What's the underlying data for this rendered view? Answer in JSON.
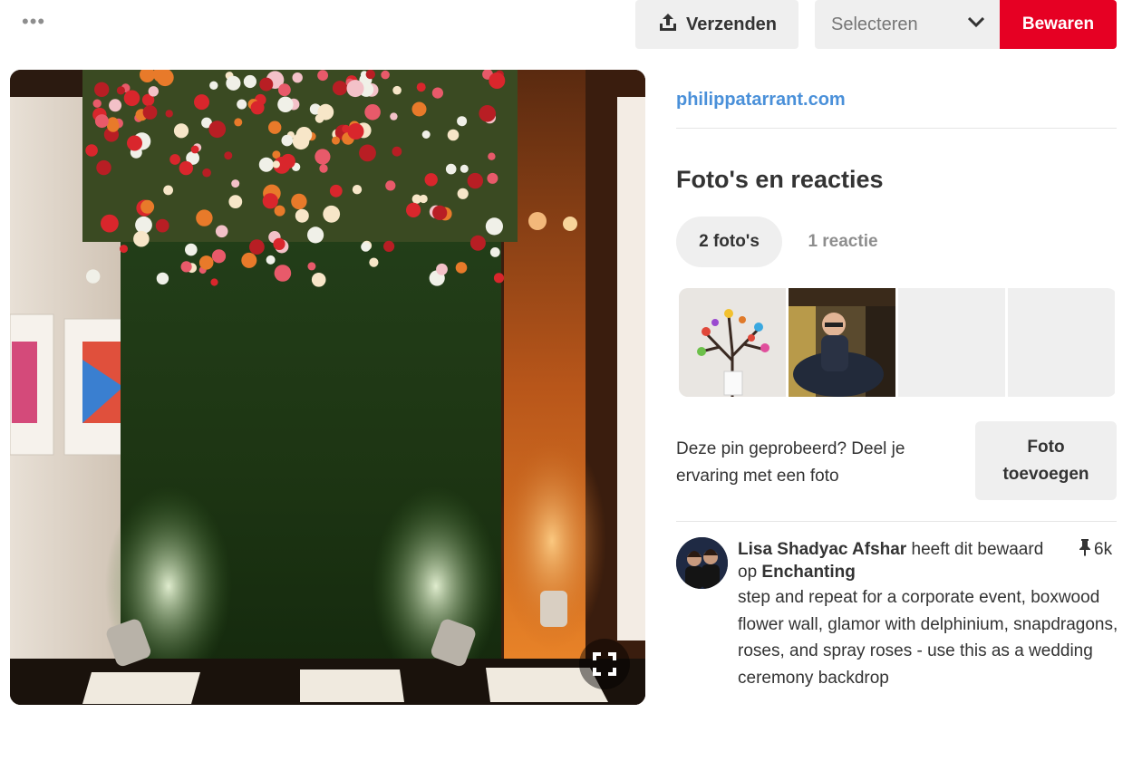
{
  "toolbar": {
    "more_icon": "more-horizontal-icon",
    "send_label": "Verzenden",
    "send_icon": "share-upload-icon",
    "select_label": "Selecteren",
    "select_icon": "chevron-down-icon",
    "save_label": "Bewaren",
    "accent_color": "#e60023"
  },
  "hero": {
    "expand_icon": "fullscreen-expand-icon"
  },
  "source_link": "philippatarrant.com",
  "photos_section": {
    "title": "Foto's en reacties",
    "tabs": [
      {
        "label": "2 foto's",
        "active": true
      },
      {
        "label": "1 reactie",
        "active": false
      }
    ]
  },
  "tried": {
    "text": "Deze pin geprobeerd? Deel je ervaring met een foto",
    "button_line1": "Foto",
    "button_line2": "toevoegen"
  },
  "comment": {
    "user": "Lisa Shadyac Afshar",
    "saved_text": "heeft dit bewaard op",
    "board": "Enchanting",
    "saves_count": "6k",
    "saves_icon": "pin-icon",
    "description": "step and repeat for a corporate event, boxwood flower wall, glamor with delphinium, snapdragons, roses, and spray roses - use this as a wedding ceremony backdrop"
  }
}
